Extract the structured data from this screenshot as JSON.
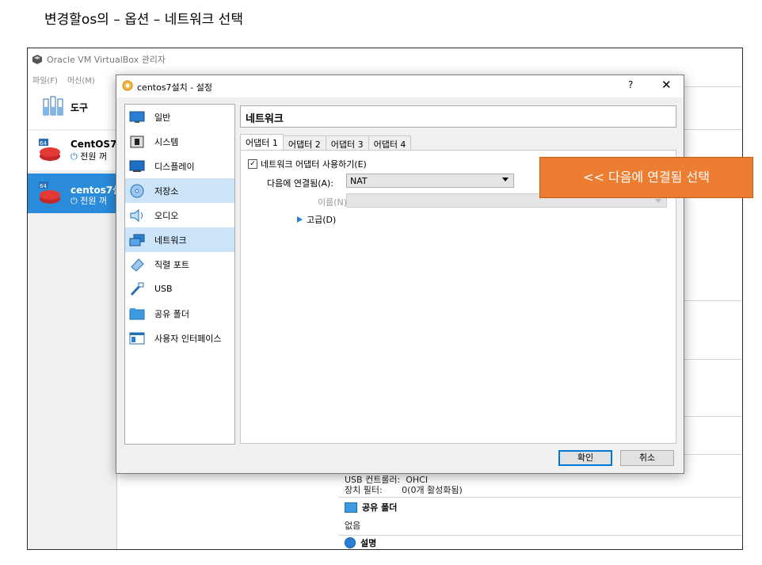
{
  "caption": "변경할os의 – 옵션 – 네트워크 선택",
  "main_window": {
    "title": "Oracle VM VirtualBox 관리자",
    "menu": [
      "파일(F)",
      "머신(M)"
    ],
    "tools_label": "도구",
    "vms": [
      {
        "name": "CentOS7(",
        "state": "전원 꺼"
      },
      {
        "name": "centos7설",
        "state": "전원 꺼"
      }
    ],
    "details": {
      "usb_line1": "USB 컨트롤러:  OHCI",
      "usb_line2": "장치 필터:       0(0개 활성화됨)",
      "shared_header": "공유 폴더",
      "shared_value": "없음",
      "desc_header": "설명"
    }
  },
  "dialog": {
    "title": "centos7설치 - 설정",
    "help": "?",
    "close": "✕",
    "categories": [
      "일반",
      "시스템",
      "디스플레이",
      "저장소",
      "오디오",
      "네트워크",
      "직렬 포트",
      "USB",
      "공유 폴더",
      "사용자 인터페이스"
    ],
    "selected_category": "네트워크",
    "section_title": "네트워크",
    "tabs": [
      "어댑터 1",
      "어댑터 2",
      "어댑터 3",
      "어댑터 4"
    ],
    "active_tab": "어댑터 1",
    "enable_checkbox": {
      "label": "네트워크 어댑터 사용하기(E)",
      "checked": true
    },
    "attached_label": "다음에 연결됨(A):",
    "attached_value": "NAT",
    "name_label": "이름(N):",
    "advanced_label": "고급(D)",
    "ok_label": "확인",
    "cancel_label": "취소"
  },
  "callout": {
    "text": "<< 다음에 연결됨 선택",
    "color": "#ed7d31"
  },
  "colors": {
    "selection": "#cce4f7",
    "vm_selected": "#2a8bdb",
    "accent": "#0078d7"
  }
}
